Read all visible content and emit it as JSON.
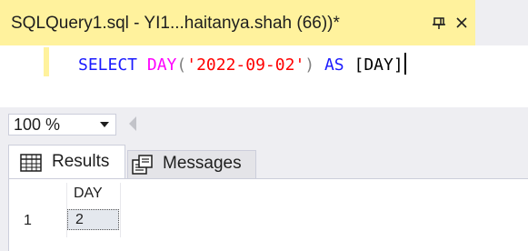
{
  "document_tab": {
    "title": "SQLQuery1.sql - YI1...haitanya.shah (66))*"
  },
  "editor": {
    "code": {
      "kw1": "SELECT",
      "fn": "DAY",
      "open_paren": "(",
      "str": "'2022-09-02'",
      "close_paren": ")",
      "kw2": "AS",
      "alias": "[DAY]"
    }
  },
  "zoom": {
    "value": "100 %"
  },
  "result_tabs": {
    "results_label": "Results",
    "messages_label": "Messages"
  },
  "results_grid": {
    "columns": [
      "DAY"
    ],
    "rows": [
      {
        "row_number": "1",
        "values": [
          "2"
        ]
      }
    ]
  },
  "colors": {
    "active_tab": "#fff29d",
    "keyword": "#1a1aff",
    "function": "#ff00ff",
    "string": "#ff0000"
  }
}
